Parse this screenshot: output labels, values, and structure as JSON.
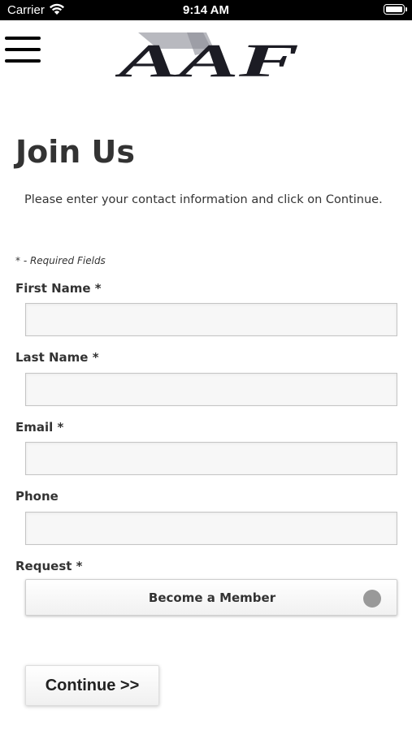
{
  "status_bar": {
    "carrier": "Carrier",
    "time": "9:14 AM"
  },
  "header": {
    "logo_text": "AAF",
    "menu_icon": "hamburger-menu-icon"
  },
  "page": {
    "title": "Join Us",
    "intro": "Please enter your contact information and click on Continue.",
    "required_note": "* - Required Fields"
  },
  "form": {
    "first_name": {
      "label": "First Name *",
      "value": "",
      "placeholder": ""
    },
    "last_name": {
      "label": "Last Name *",
      "value": "",
      "placeholder": ""
    },
    "email": {
      "label": "Email *",
      "value": "",
      "placeholder": ""
    },
    "phone": {
      "label": "Phone",
      "value": "",
      "placeholder": ""
    },
    "request": {
      "label": "Request *",
      "selected": "Become a Member"
    },
    "continue_label": "Continue >>"
  }
}
